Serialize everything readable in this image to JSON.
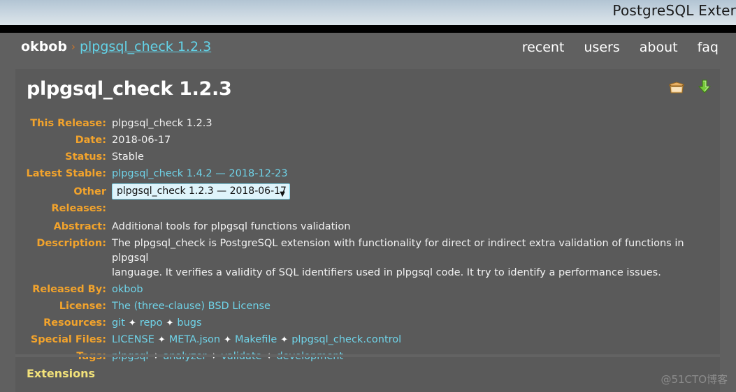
{
  "browser": {
    "site_title": "PostgreSQL Exter"
  },
  "nav": {
    "breadcrumb": {
      "user": "okbob",
      "separator": "›",
      "current": "plpgsql_check 1.2.3"
    },
    "links": [
      {
        "label": "recent"
      },
      {
        "label": "users"
      },
      {
        "label": "about"
      },
      {
        "label": "faq"
      }
    ]
  },
  "page": {
    "title": "plpgsql_check 1.2.3",
    "icons": [
      {
        "name": "package-box-icon",
        "title": "package"
      },
      {
        "name": "download-arrow-icon",
        "title": "download"
      }
    ]
  },
  "metadata": {
    "this_release": {
      "label": "This Release:",
      "value": "plpgsql_check 1.2.3"
    },
    "date": {
      "label": "Date:",
      "value": "2018-06-17"
    },
    "status": {
      "label": "Status:",
      "value": "Stable"
    },
    "latest_stable": {
      "label": "Latest Stable:",
      "value": "plpgsql_check 1.4.2 — 2018-12-23"
    },
    "other_releases": {
      "label": "Other Releases:",
      "selected": "plpgsql_check 1.2.3 — 2018-06-17",
      "arrow": "▼",
      "options": [
        "plpgsql_check 1.2.3 — 2018-06-17"
      ]
    },
    "abstract": {
      "label": "Abstract:",
      "value": "Additional tools for plpgsql functions validation"
    },
    "description": {
      "label": "Description:",
      "line1": "The plpgsql_check is PostgreSQL extension with functionality for direct or indirect extra validation of functions in plpgsql",
      "line2": "language. It verifies a validity of SQL identifiers used in plpgsql code. It try to identify a performance issues."
    },
    "released_by": {
      "label": "Released By:",
      "value": "okbob"
    },
    "license": {
      "label": "License:",
      "value": "The (three-clause) BSD License"
    },
    "resources": {
      "label": "Resources:",
      "separator": "✦",
      "items": [
        "git",
        "repo",
        "bugs"
      ]
    },
    "special_files": {
      "label": "Special Files:",
      "separator": "✦",
      "items": [
        "LICENSE",
        "META.json",
        "Makefile",
        "plpgsql_check.control"
      ]
    },
    "tags": {
      "label": "Tags:",
      "separator": "✦",
      "items": [
        "plpgsql",
        "analyzer",
        "validate",
        "development"
      ]
    }
  },
  "sections": {
    "extensions_heading": "Extensions"
  },
  "watermark": "@51CTO博客",
  "colors": {
    "label_orange": "#f2a32c",
    "link_cyan": "#6fd3e8",
    "heading_yellow": "#f2e27a",
    "panel_bg": "#5a5a5a",
    "page_bg": "#606060",
    "crumb_sep": "#c8742a"
  }
}
